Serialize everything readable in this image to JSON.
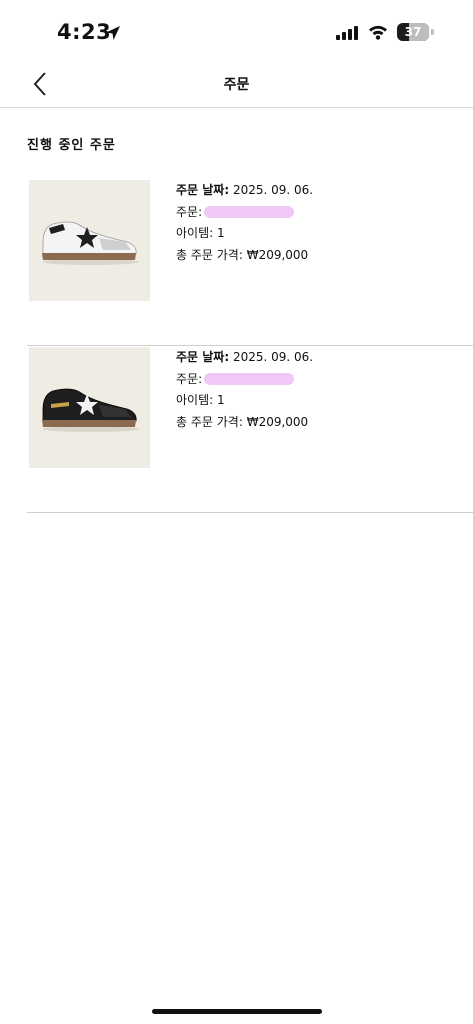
{
  "status_bar": {
    "time": "4:23",
    "battery": "37",
    "battery_level_percent": 37
  },
  "nav": {
    "title": "주문"
  },
  "section": {
    "title": "진행 중인 주문"
  },
  "orders": [
    {
      "date_label": "주문 날짜:",
      "date": "2025. 09. 06.",
      "order_label": "주문:",
      "items_label": "아이템:",
      "items": "1",
      "total_label": "총 주문 가격:",
      "total": "₩209,000",
      "shoe_color": "#f4f4f4",
      "star_color": "#1f1f1f"
    },
    {
      "date_label": "주문 날짜:",
      "date": "2025. 09. 06.",
      "order_label": "주문:",
      "items_label": "아이템:",
      "items": "1",
      "total_label": "총 주문 가격:",
      "total": "₩209,000",
      "shoe_color": "#1e1e1e",
      "star_color": "#f4f4f4"
    }
  ],
  "colors": {
    "accent_redaction": "#f0c8f6",
    "thumb_bg": "#efece4",
    "divider": "#cfcfcf"
  }
}
